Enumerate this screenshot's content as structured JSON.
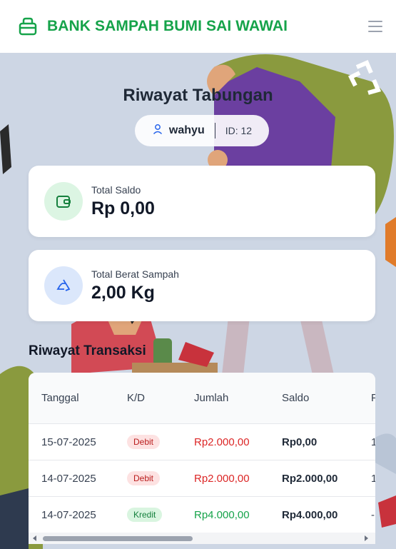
{
  "header": {
    "title": "BANK SAMPAH BUMI SAI WAWAI",
    "brand_icon": "bag-icon",
    "menu_icon": "hamburger-menu-icon"
  },
  "page": {
    "title": "Riwayat Tabungan"
  },
  "user": {
    "name": "wahyu",
    "id_label": "ID: 12",
    "icon": "user-icon"
  },
  "cards": {
    "saldo": {
      "label": "Total Saldo",
      "value": "Rp 0,00",
      "icon": "wallet-icon"
    },
    "berat": {
      "label": "Total Berat Sampah",
      "value": "2,00 Kg",
      "icon": "recycle-icon"
    }
  },
  "transactions": {
    "title": "Riwayat Transaksi",
    "columns": [
      "Tanggal",
      "K/D",
      "Jumlah",
      "Saldo",
      "F"
    ],
    "rows": [
      {
        "tanggal": "15-07-2025",
        "type": "Debit",
        "jumlah": "Rp2.000,00",
        "saldo": "Rp0,00",
        "extra": "1"
      },
      {
        "tanggal": "14-07-2025",
        "type": "Debit",
        "jumlah": "Rp2.000,00",
        "saldo": "Rp2.000,00",
        "extra": "1"
      },
      {
        "tanggal": "14-07-2025",
        "type": "Kredit",
        "jumlah": "Rp4.000,00",
        "saldo": "Rp4.000,00",
        "extra": "-"
      }
    ]
  },
  "colors": {
    "brand": "#16a34a",
    "debit": "#dc2626",
    "kredit": "#16a34a"
  }
}
